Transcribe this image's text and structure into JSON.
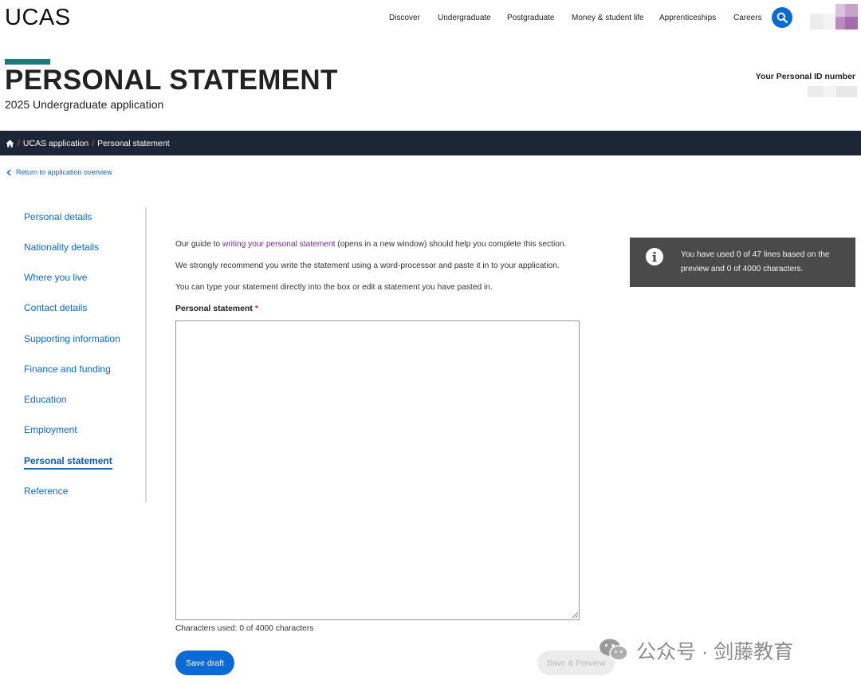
{
  "header": {
    "logo": "UCAS",
    "nav": [
      "Discover",
      "Undergraduate",
      "Postgraduate",
      "Money & student life",
      "Apprenticeships",
      "Careers"
    ]
  },
  "title": {
    "heading": "PERSONAL STATEMENT",
    "subheading": "2025 Undergraduate application",
    "id_label": "Your Personal ID number"
  },
  "breadcrumb": {
    "items": [
      "UCAS application",
      "Personal statement"
    ]
  },
  "return_link": "Return to application overview",
  "sidebar": {
    "items": [
      {
        "label": "Personal details"
      },
      {
        "label": "Nationality details"
      },
      {
        "label": "Where you live"
      },
      {
        "label": "Contact details"
      },
      {
        "label": "Supporting information"
      },
      {
        "label": "Finance and funding"
      },
      {
        "label": "Education"
      },
      {
        "label": "Employment"
      },
      {
        "label": "Personal statement",
        "active": true
      },
      {
        "label": "Reference"
      }
    ]
  },
  "main": {
    "guide_prefix": "Our guide to ",
    "guide_link": "writing your personal statement",
    "guide_suffix": " (opens in a new window) should help you complete this section.",
    "recommend": "We strongly recommend you write the statement using a word-processor and paste it in to your application.",
    "type_note": "You can type your statement directly into the box or edit a statement you have pasted in.",
    "field_label": "Personal statement",
    "required_mark": "*",
    "statement_value": "",
    "char_count": "Characters used: 0 of 4000 characters",
    "save_draft": "Save draft",
    "save_preview": "Save & Preview"
  },
  "info_panel": {
    "text": "You have used 0 of 47 lines based on the preview and 0 of 4000 characters."
  },
  "watermark": {
    "text": "公众号 · 剑藤教育"
  },
  "colors": {
    "accent_blue": "#0a6ad6",
    "breadcrumb_bg": "#1d2636",
    "teal_bar": "#1c7a80",
    "info_bg": "#4a4a4a",
    "link_purple": "#7a2a91",
    "required_red": "#d0312d"
  }
}
